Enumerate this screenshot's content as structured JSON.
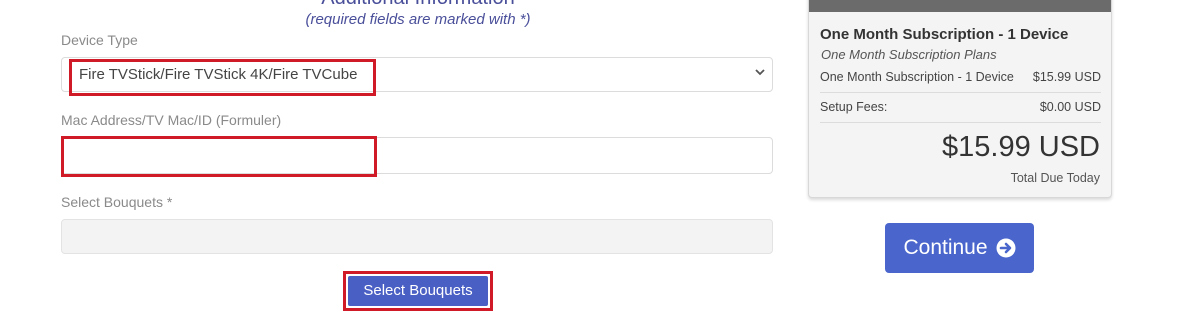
{
  "form": {
    "section_heading": "Additional Information",
    "required_note": "(required fields are marked with *)",
    "device_type": {
      "label": "Device Type",
      "selected_value": "Fire TVStick/Fire TVStick 4K/Fire TVCube"
    },
    "mac_address": {
      "label": "Mac Address/TV Mac/ID (Formuler)",
      "value": ""
    },
    "bouquets": {
      "label": "Select Bouquets *",
      "value": ""
    },
    "select_bouquets_button": "Select Bouquets"
  },
  "order_summary": {
    "product_title": "One Month Subscription - 1 Device",
    "product_group": "One Month Subscription Plans",
    "line_item": {
      "label": "One Month Subscription - 1 Device",
      "amount": "$15.99 USD"
    },
    "setup_fees": {
      "label": "Setup Fees:",
      "amount": "$0.00 USD"
    },
    "total_amount": "$15.99 USD",
    "total_label": "Total Due Today"
  },
  "continue_button": {
    "label": "Continue",
    "icon": "arrow-circle-right-icon"
  },
  "colors": {
    "heading": "#4a4f9a",
    "highlight": "#d01a28",
    "button_primary": "#4a66cc"
  }
}
